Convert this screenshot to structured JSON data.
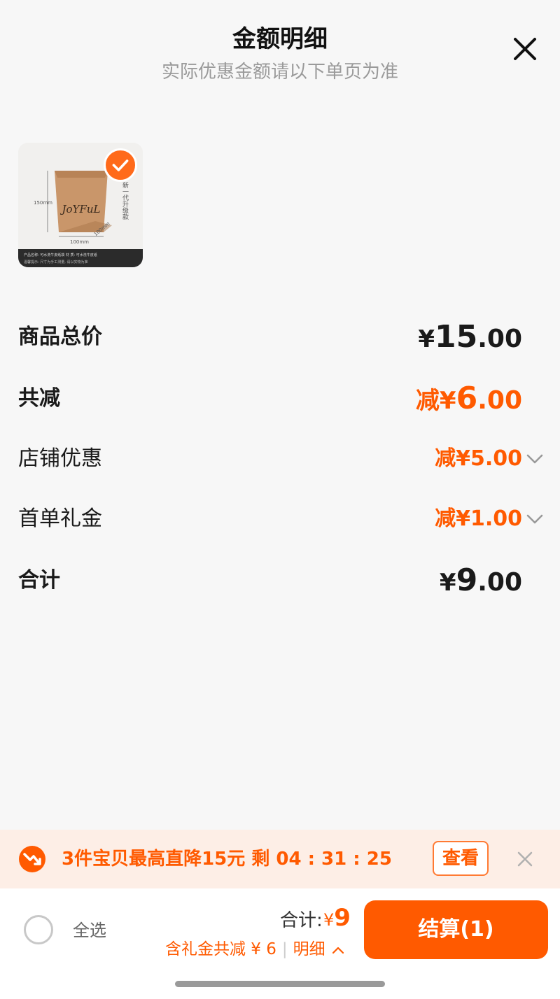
{
  "header": {
    "title": "金额明细",
    "subtitle": "实际优惠金额请以下单页为准"
  },
  "product": {
    "image_text": {
      "brand": "JoYFuL",
      "height": "150mm",
      "width": "100mm",
      "depth": "100mm",
      "side_label": "新一代升级款",
      "footer_row1": "产品名称: 可水洗牛皮纸袋    材  质: 可水洗牛皮纸",
      "footer_row2": "温馨提示: 尺寸为手工测量, 请以实物为准"
    }
  },
  "summary": {
    "total_price": {
      "label": "商品总价",
      "currency": "¥",
      "int": "15",
      "dec": ".00"
    },
    "total_discount": {
      "label": "共减",
      "prefix": "减¥",
      "int": "6",
      "dec": ".00"
    },
    "store_discount": {
      "label": "店铺优惠",
      "value": "减¥5.00"
    },
    "first_order_gift": {
      "label": "首单礼金",
      "value": "减¥1.00"
    },
    "grand_total": {
      "label": "合计",
      "currency": "¥",
      "int": "9",
      "dec": ".00"
    }
  },
  "promo": {
    "text": "3件宝贝最高直降15元 剩 04 : 31 : 25",
    "button": "查看"
  },
  "bottom": {
    "select_all": "全选",
    "total_label": "合计:",
    "total_currency": "¥",
    "total_value": "9",
    "sub_text": "含礼金共减 ¥ 6",
    "detail_link": "明细",
    "checkout": "结算(1)"
  },
  "colors": {
    "accent": "#ff5a00",
    "promo_bg": "#fdeee6",
    "page_bg": "#f7f7f7"
  }
}
